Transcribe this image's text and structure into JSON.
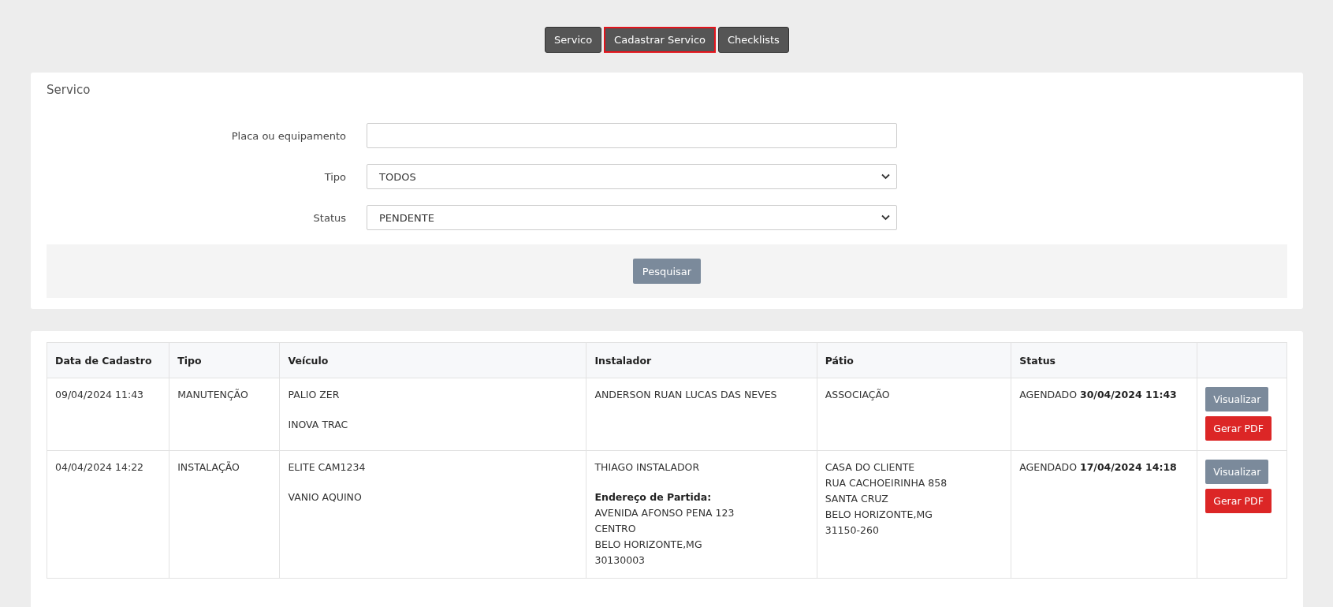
{
  "nav_tabs": [
    {
      "label": "Servico",
      "selected": false
    },
    {
      "label": "Cadastrar Servico",
      "selected": true
    },
    {
      "label": "Checklists",
      "selected": false
    }
  ],
  "filter_panel": {
    "title": "Servico",
    "fields": [
      {
        "label": "Placa ou equipamento",
        "kind": "text"
      },
      {
        "label": "Tipo",
        "kind": "select",
        "value": "TODOS"
      },
      {
        "label": "Status",
        "kind": "select",
        "value": "PENDENTE"
      }
    ],
    "search_button": "Pesquisar"
  },
  "table": {
    "columns": [
      "Data de Cadastro",
      "Tipo",
      "Veículo",
      "Instalador",
      "Pátio",
      "Status"
    ],
    "rows": [
      {
        "date": "09/04/2024 11:43",
        "type": "MANUTENÇÃO",
        "vehicle": [
          "PALIO ZER",
          "INOVA TRAC"
        ],
        "installer": {
          "name": "ANDERSON RUAN LUCAS DAS NEVES"
        },
        "yard": [
          "ASSOCIAÇÃO"
        ],
        "status": "AGENDADO **30/04/2024 11:43**",
        "actions": [
          {
            "label": "Visualizar",
            "kind": "view"
          },
          {
            "label": "Gerar PDF",
            "kind": "pdf"
          }
        ]
      },
      {
        "date": "04/04/2024 14:22",
        "type": "INSTALAÇÃO",
        "vehicle": [
          "ELITE CAM1234",
          "VANIO AQUINO"
        ],
        "installer": {
          "name": "THIAGO INSTALADOR",
          "address_label": "Endereço de Partida:",
          "address_lines": [
            "AVENIDA AFONSO PENA 123",
            "CENTRO",
            "BELO HORIZONTE,MG",
            "30130003"
          ]
        },
        "yard": [
          "CASA DO CLIENTE",
          "RUA CACHOEIRINHA 858",
          "SANTA CRUZ",
          "BELO HORIZONTE,MG",
          "31150-260"
        ],
        "status": "AGENDADO **17/04/2024 14:18**",
        "actions": [
          {
            "label": "Visualizar",
            "kind": "view"
          },
          {
            "label": "Gerar PDF",
            "kind": "pdf"
          }
        ]
      }
    ]
  }
}
